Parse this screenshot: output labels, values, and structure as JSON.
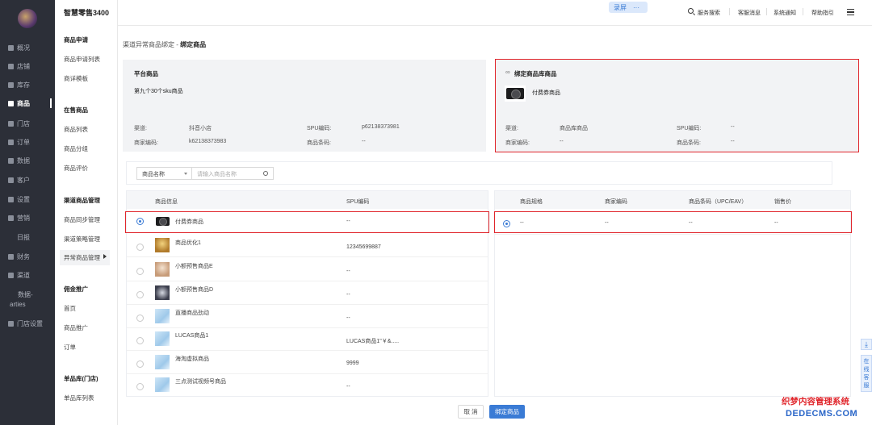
{
  "app": {
    "name": "智慧零售3400"
  },
  "topbar": {
    "record_label": "录屏",
    "record_more": "···",
    "search_label": "服务搜索",
    "service_msg": "客服消息",
    "system_notice": "系统通知",
    "help": "帮助指引"
  },
  "nav": {
    "items": [
      {
        "label": "概况"
      },
      {
        "label": "店铺"
      },
      {
        "label": "库存"
      },
      {
        "label": "商品"
      },
      {
        "label": "门店"
      },
      {
        "label": "订单"
      },
      {
        "label": "数据"
      },
      {
        "label": "客户"
      },
      {
        "label": "设置"
      },
      {
        "label": "营销"
      },
      {
        "label": "日报"
      },
      {
        "label": "财务"
      },
      {
        "label": "渠道"
      },
      {
        "label": "数据-"
      },
      {
        "label": "arties"
      },
      {
        "label": "门店设置"
      }
    ]
  },
  "submenu": {
    "items": [
      {
        "label": "商品申请"
      },
      {
        "label": "商品申请列表"
      },
      {
        "label": "商详模板"
      },
      {
        "label": "在售商品"
      },
      {
        "label": "商品列表"
      },
      {
        "label": "商品分组"
      },
      {
        "label": "商品评价"
      },
      {
        "label": "渠道商品管理"
      },
      {
        "label": "商品同步管理"
      },
      {
        "label": "渠道策略管理"
      },
      {
        "label": "异常商品管理"
      },
      {
        "label": "佣金推广"
      },
      {
        "label": "首页"
      },
      {
        "label": "商品推广"
      },
      {
        "label": "订单"
      },
      {
        "label": "单品库(门店)"
      },
      {
        "label": "单品库列表"
      }
    ]
  },
  "breadcrumb": {
    "parent": "渠道异常商品绑定",
    "separator": "-",
    "current": "绑定商品"
  },
  "platform_card": {
    "title": "平台商品",
    "product_name": "第九个30个sku商品",
    "channel_label": "渠道:",
    "channel_value": "抖音小店",
    "spu_label": "SPU编码:",
    "spu_value": "p62138373981",
    "merchant_label": "商家编码:",
    "merchant_value": "k62138373983",
    "barcode_label": "商品条码:",
    "barcode_value": "--"
  },
  "bound_card": {
    "title": "绑定商品库商品",
    "product_name": "付费券商品",
    "channel_label": "渠道:",
    "channel_value": "商品库商品",
    "spu_label": "SPU编码:",
    "spu_value": "--",
    "merchant_label": "商家编码:",
    "merchant_value": "--",
    "barcode_label": "商品条码:",
    "barcode_value": "--"
  },
  "filter": {
    "select_value": "商品名称",
    "input_placeholder": "请输入商品名称"
  },
  "left_table": {
    "headers": {
      "info": "商品信息",
      "spu": "SPU编码"
    },
    "rows": [
      {
        "name": "付费券商品",
        "spu": "--",
        "selected": true
      },
      {
        "name": "商品优化1",
        "spu": "12345699887",
        "selected": false
      },
      {
        "name": "小额预售商品E",
        "spu": "--",
        "selected": false
      },
      {
        "name": "小额预售商品D",
        "spu": "--",
        "selected": false
      },
      {
        "name": "直播商品劲动",
        "spu": "--",
        "selected": false
      },
      {
        "name": "LUCAS商品1",
        "spu": "LUCAS商品1\"￥&.....",
        "selected": false
      },
      {
        "name": "海淘虚拟商品",
        "spu": "9999",
        "selected": false
      },
      {
        "name": "三点测试视频号商品",
        "spu": "--",
        "selected": false
      }
    ]
  },
  "right_table": {
    "headers": {
      "spec": "商品规格",
      "merchant": "商家编码",
      "barcode": "商品条码（UPC/EAV）",
      "price": "销售价"
    },
    "rows": [
      {
        "spec": "--",
        "merchant": "--",
        "barcode": "--",
        "price": "--",
        "selected": true
      }
    ]
  },
  "actions": {
    "cancel": "取 消",
    "confirm": "绑定商品"
  },
  "float_tools": {
    "service_1": "在",
    "service_2": "线",
    "service_3": "客",
    "service_4": "服"
  },
  "watermark": {
    "line1": "织梦内容管理系统",
    "line2": "DEDECMS.COM"
  },
  "colors": {
    "accent": "#3a7bd5",
    "highlight": "#e0252b",
    "sidebar": "#2c2f38"
  }
}
